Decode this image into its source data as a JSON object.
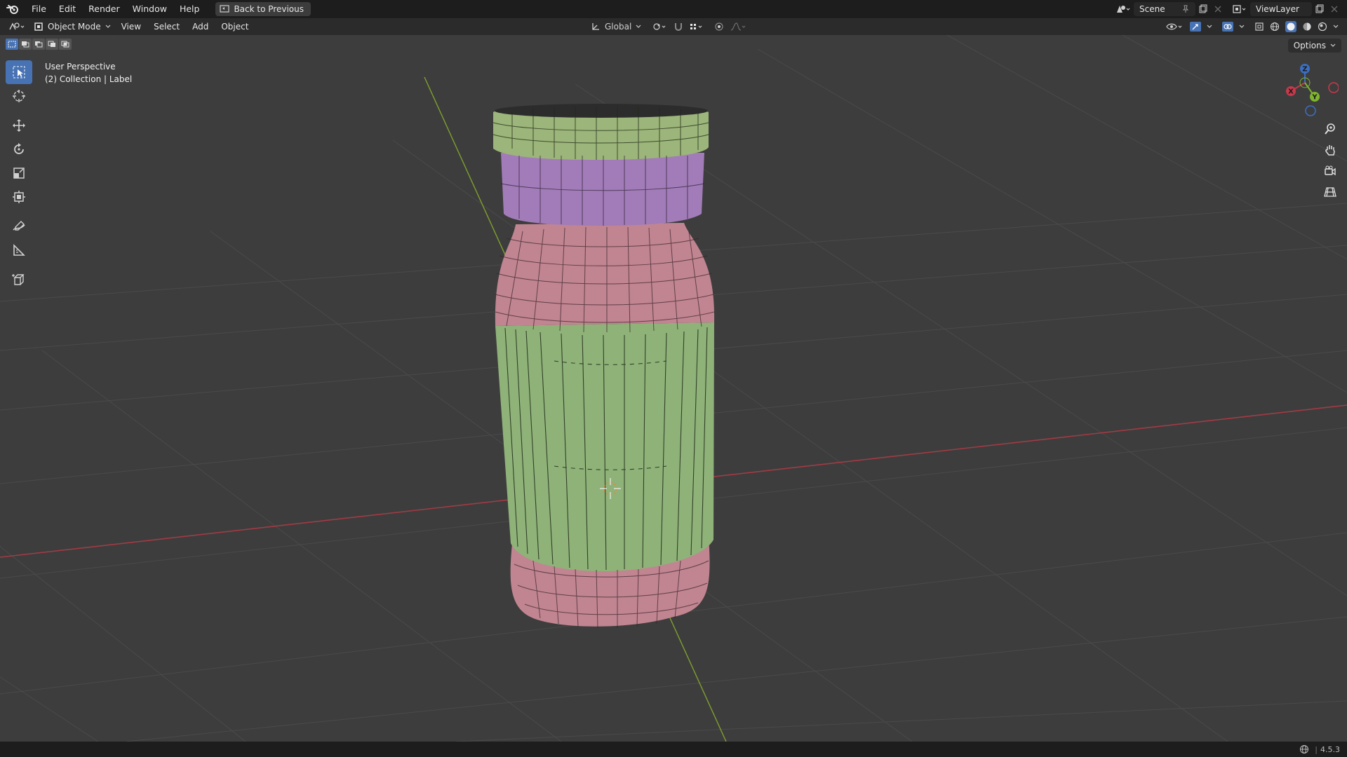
{
  "topbar": {
    "menus": [
      "File",
      "Edit",
      "Render",
      "Window",
      "Help"
    ],
    "back_button": "Back to Previous",
    "scene": "Scene",
    "view_layer": "ViewLayer"
  },
  "header": {
    "mode": "Object Mode",
    "menus": [
      "View",
      "Select",
      "Add",
      "Object"
    ],
    "orientation": "Global",
    "options": "Options"
  },
  "viewport": {
    "perspective": "User Perspective",
    "collection": "(2) Collection | Label"
  },
  "gizmo": {
    "x": "X",
    "y": "Y",
    "z": "Z"
  },
  "statusbar": {
    "version": "4.5.3"
  },
  "colors": {
    "cap": "#9cb57a",
    "ring": "#a27cb8",
    "neck": "#c08591",
    "label": "#8fb279",
    "accent": "#4772b3",
    "x_axis": "#a23b45",
    "y_axis": "#7fa02e"
  }
}
